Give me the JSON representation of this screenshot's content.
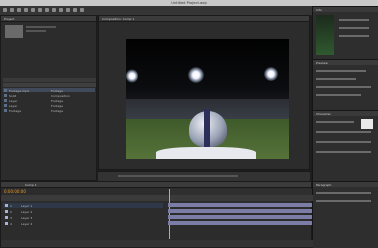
{
  "app": {
    "title": "Untitled Project.aep"
  },
  "project_panel": {
    "tab_label": "Project",
    "items": [
      {
        "name": "Footage.mp4",
        "type": "Footage"
      },
      {
        "name": "Solid",
        "type": "Composition"
      },
      {
        "name": "Layer",
        "type": "Footage"
      },
      {
        "name": "Layer",
        "type": "Footage"
      },
      {
        "name": "Footage",
        "type": "Footage"
      }
    ]
  },
  "viewer": {
    "tab_label": "Composition: Comp 1"
  },
  "right_panels": {
    "info_label": "Info",
    "audio_label": "Audio",
    "preview_label": "Preview",
    "character_label": "Character",
    "paragraph_label": "Paragraph"
  },
  "timeline": {
    "tab_label": "Comp 1",
    "timecode": "0:00:00:00",
    "layers": [
      {
        "num": "1",
        "name": "Layer 1"
      },
      {
        "num": "2",
        "name": "Layer 2"
      },
      {
        "num": "3",
        "name": "Layer 3"
      },
      {
        "num": "4",
        "name": "Layer 4"
      }
    ]
  },
  "colors": {
    "timecode": "#e89b2a",
    "track": "#7b7da6",
    "playhead": "#ff9a22"
  }
}
